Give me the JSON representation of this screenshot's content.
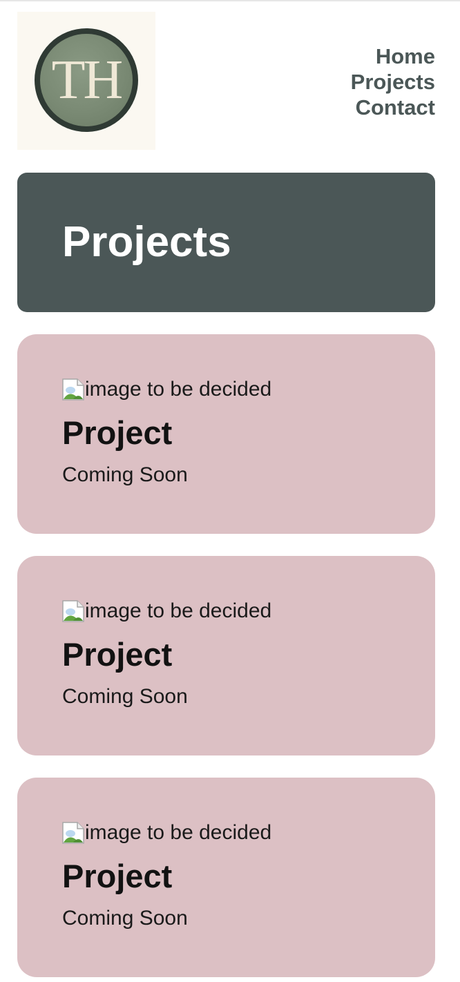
{
  "logo": {
    "initials": "TH",
    "icon": "th-monogram-logo"
  },
  "nav": {
    "items": [
      "Home",
      "Projects",
      "Contact"
    ]
  },
  "hero": {
    "title": "Projects"
  },
  "projects": [
    {
      "image_alt": "image to be decided",
      "title": "Project",
      "status": "Coming Soon"
    },
    {
      "image_alt": "image to be decided",
      "title": "Project",
      "status": "Coming Soon"
    },
    {
      "image_alt": "image to be decided",
      "title": "Project",
      "status": "Coming Soon"
    }
  ],
  "colors": {
    "slate": "#4b5757",
    "card_pink": "#dcc0c4",
    "logo_bg": "#fbf8f1",
    "logo_green": "#7a8a74"
  }
}
